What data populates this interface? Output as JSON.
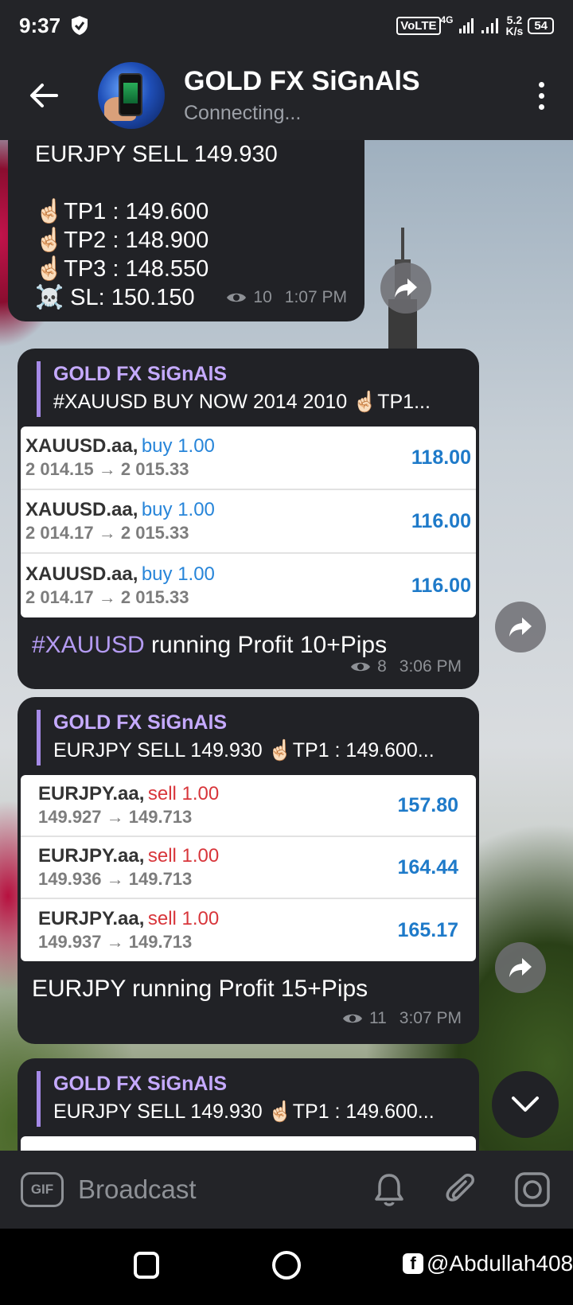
{
  "status_bar": {
    "time": "9:37",
    "network": "VoLTE",
    "network_gen": "4G",
    "speed_value": "5.2",
    "speed_unit": "K/s",
    "battery": "54"
  },
  "header": {
    "title": "GOLD FX SiGnAlS",
    "subtitle": "Connecting..."
  },
  "messages": [
    {
      "lines": [
        "EURJPY SELL 149.930",
        "",
        "☝🏻TP1 : 149.600",
        "☝🏻TP2 : 148.900",
        "☝🏻TP3 : 148.550",
        "☠️ SL: 150.150"
      ],
      "views": "10",
      "time": "1:07 PM"
    },
    {
      "reply_name": "GOLD FX SiGnAlS",
      "reply_text": "#XAUUSD BUY NOW 2014 2010 ☝🏻TP1...",
      "trades": [
        {
          "symbol": "XAUUSD.aa,",
          "dir": "buy 1.00",
          "prices": "2 014.15 → 2 015.33",
          "profit": "118.00"
        },
        {
          "symbol": "XAUUSD.aa,",
          "dir": "buy 1.00",
          "prices": "2 014.17 → 2 015.33",
          "profit": "116.00"
        },
        {
          "symbol": "XAUUSD.aa,",
          "dir": "buy 1.00",
          "prices": "2 014.17 → 2 015.33",
          "profit": "116.00"
        }
      ],
      "caption_tag": "#XAUUSD",
      "caption_rest": " running Profit 10+Pips",
      "views": "8",
      "time": "3:06 PM"
    },
    {
      "reply_name": "GOLD FX SiGnAlS",
      "reply_text": "EURJPY SELL 149.930 ☝🏻TP1 : 149.600...",
      "trades": [
        {
          "symbol": "EURJPY.aa,",
          "dir": "sell 1.00",
          "prices": "149.927 → 149.713",
          "profit": "157.80"
        },
        {
          "symbol": "EURJPY.aa,",
          "dir": "sell 1.00",
          "prices": "149.936 → 149.713",
          "profit": "164.44"
        },
        {
          "symbol": "EURJPY.aa,",
          "dir": "sell 1.00",
          "prices": "149.937 → 149.713",
          "profit": "165.17"
        }
      ],
      "caption": "EURJPY running Profit 15+Pips",
      "views": "11",
      "time": "3:07 PM"
    },
    {
      "reply_name": "GOLD FX SiGnAlS",
      "reply_text": "EURJPY SELL 149.930 ☝🏻TP1 : 149.600..."
    }
  ],
  "input": {
    "gif_label": "GIF",
    "placeholder": "Broadcast"
  },
  "watermark": "@Abdullah408",
  "icons": [
    "shield-icon",
    "back-arrow-icon",
    "more-vert-icon",
    "eye-icon",
    "forward-icon",
    "chevron-down-icon",
    "bell-icon",
    "paperclip-icon",
    "camera-icon",
    "facebook-icon"
  ]
}
